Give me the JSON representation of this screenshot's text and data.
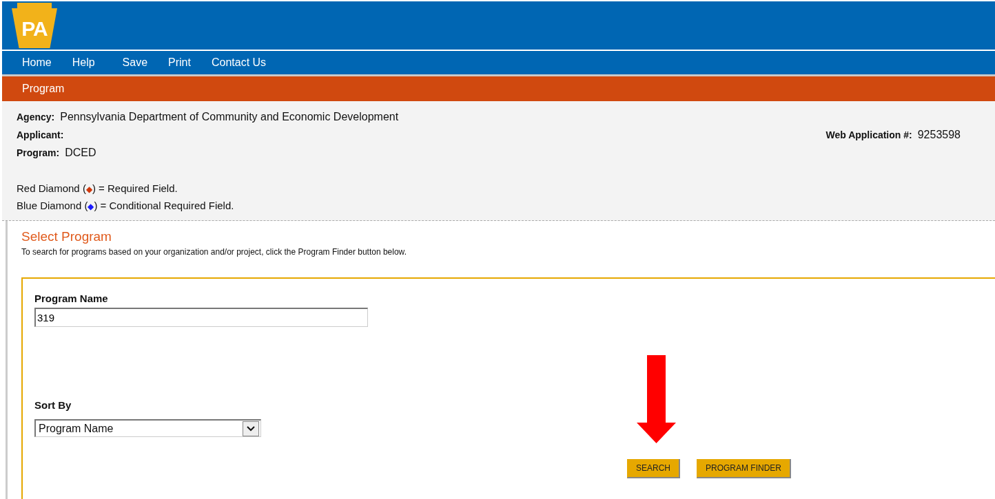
{
  "logo": {
    "text": "PA"
  },
  "nav": [
    {
      "label": "Home"
    },
    {
      "label": "Help"
    },
    {
      "label": "Save"
    },
    {
      "label": "Print"
    },
    {
      "label": "Contact Us"
    }
  ],
  "section_bar": {
    "title": "Program"
  },
  "info": {
    "fields": [
      {
        "label": "Agency:",
        "value": "Pennsylvania Department of Community and Economic Development"
      },
      {
        "label": "Applicant:"
      },
      {
        "label": "Program:",
        "value": "DCED"
      }
    ],
    "web_application": {
      "label": "Web Application #:",
      "value": "9253598"
    },
    "legend": [
      {
        "before": "Red Diamond (",
        "symbol": "◆",
        "after": ") = Required Field.",
        "color": "#d0380c"
      },
      {
        "before": "Blue Diamond (",
        "symbol": "◆",
        "after": ") = Conditional Required Field.",
        "color": "#1a1aff"
      }
    ]
  },
  "select_program": {
    "title": "Select Program",
    "instructions": "To search for programs based on your organization and/or project, click the Program Finder button below.",
    "program_name": {
      "label": "Program Name",
      "value": "319"
    },
    "sort_by": {
      "label": "Sort By",
      "value": "Program Name"
    },
    "buttons": [
      {
        "label": "SEARCH",
        "highlighted": true
      },
      {
        "label": "PROGRAM FINDER",
        "highlighted": false
      }
    ]
  }
}
